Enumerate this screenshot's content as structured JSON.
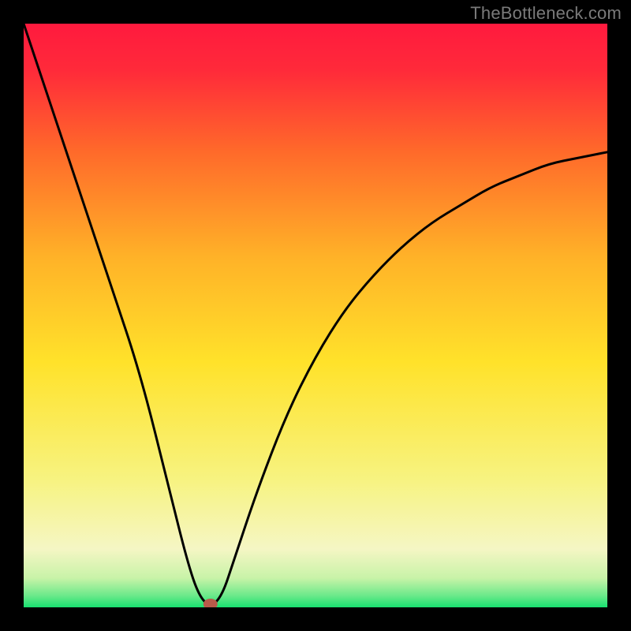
{
  "watermark": "TheBottleneck.com",
  "chart_data": {
    "type": "line",
    "title": "",
    "xlabel": "",
    "ylabel": "",
    "xlim": [
      0,
      100
    ],
    "ylim": [
      0,
      100
    ],
    "grid": false,
    "background": "red-yellow-green vertical heatmap gradient",
    "series": [
      {
        "name": "bottleneck-curve",
        "x": [
          0,
          5,
          10,
          15,
          20,
          25,
          28,
          30,
          32,
          34,
          36,
          40,
          45,
          50,
          55,
          60,
          65,
          70,
          75,
          80,
          85,
          90,
          95,
          100
        ],
        "y": [
          100,
          85,
          70,
          55,
          40,
          20,
          8,
          2,
          0,
          2,
          8,
          20,
          33,
          43,
          51,
          57,
          62,
          66,
          69,
          72,
          74,
          76,
          77,
          78
        ]
      }
    ],
    "minimum_marker": {
      "x": 32,
      "y": 0,
      "color": "#b85a4a"
    }
  },
  "colors": {
    "frame": "#000000",
    "gradient_top": "#ff1a3e",
    "gradient_mid_upper": "#ff8a1f",
    "gradient_mid": "#ffde2a",
    "gradient_pale": "#faf6b8",
    "gradient_bottom": "#18e070",
    "curve": "#000000",
    "marker": "#b85a4a"
  }
}
